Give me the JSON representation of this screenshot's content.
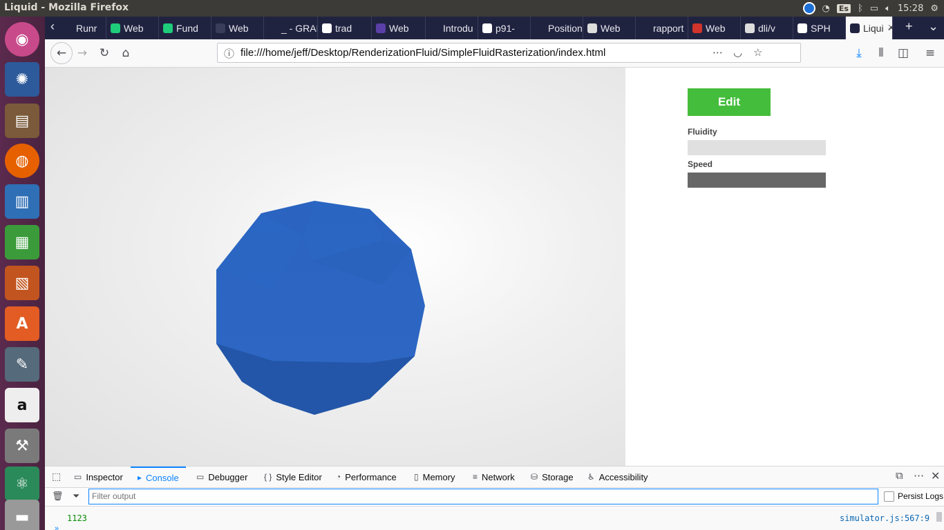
{
  "panel": {
    "window_title": "Liquid - Mozilla Firefox",
    "keyboard_layout": "Es",
    "clock": "15:28"
  },
  "tabs": [
    {
      "label": "Runr",
      "icon_color": "#202340"
    },
    {
      "label": "Web",
      "icon_color": "#1ecc7a"
    },
    {
      "label": "Fund",
      "icon_color": "#1ecc7a"
    },
    {
      "label": "Web",
      "icon_color": "#3a3d5a"
    },
    {
      "label": "_ - GRAD",
      "icon_color": "#202340"
    },
    {
      "label": "trad",
      "icon_color": "#ffffff"
    },
    {
      "label": "Web",
      "icon_color": "#5b3fa8"
    },
    {
      "label": "Introdu",
      "icon_color": "#202340"
    },
    {
      "label": "p91-",
      "icon_color": "#ffffff"
    },
    {
      "label": "Position",
      "icon_color": "#202340"
    },
    {
      "label": "Web",
      "icon_color": "#dddddd"
    },
    {
      "label": "rapport",
      "icon_color": "#202340"
    },
    {
      "label": "Web",
      "icon_color": "#d0342c"
    },
    {
      "label": "dli/v",
      "icon_color": "#dddddd"
    },
    {
      "label": "SPH",
      "icon_color": "#ffffff"
    },
    {
      "label": "Liqui",
      "icon_color": "#202340",
      "active": true
    }
  ],
  "navbar": {
    "url": "file:///home/jeff/Desktop/RenderizationFluid/SimpleFluidRasterization/index.html"
  },
  "side_panel": {
    "edit_label": "Edit",
    "fluidity_label": "Fluidity",
    "speed_label": "Speed",
    "fluidity_value": 0.0,
    "speed_value": 1.0,
    "edit_color": "#44bd3c"
  },
  "devtools": {
    "tabs": [
      {
        "label": "Inspector",
        "icon": "inspector-icon"
      },
      {
        "label": "Console",
        "icon": "console-icon",
        "active": true
      },
      {
        "label": "Debugger",
        "icon": "debugger-icon"
      },
      {
        "label": "Style Editor",
        "icon": "style-editor-icon"
      },
      {
        "label": "Performance",
        "icon": "performance-icon"
      },
      {
        "label": "Memory",
        "icon": "memory-icon"
      },
      {
        "label": "Network",
        "icon": "network-icon"
      },
      {
        "label": "Storage",
        "icon": "storage-icon"
      },
      {
        "label": "Accessibility",
        "icon": "accessibility-icon"
      }
    ],
    "filter_placeholder": "Filter output",
    "persist_logs_label": "Persist Logs",
    "console_lines": [
      {
        "value": "1123",
        "source": "simulator.js:567:9"
      }
    ]
  }
}
